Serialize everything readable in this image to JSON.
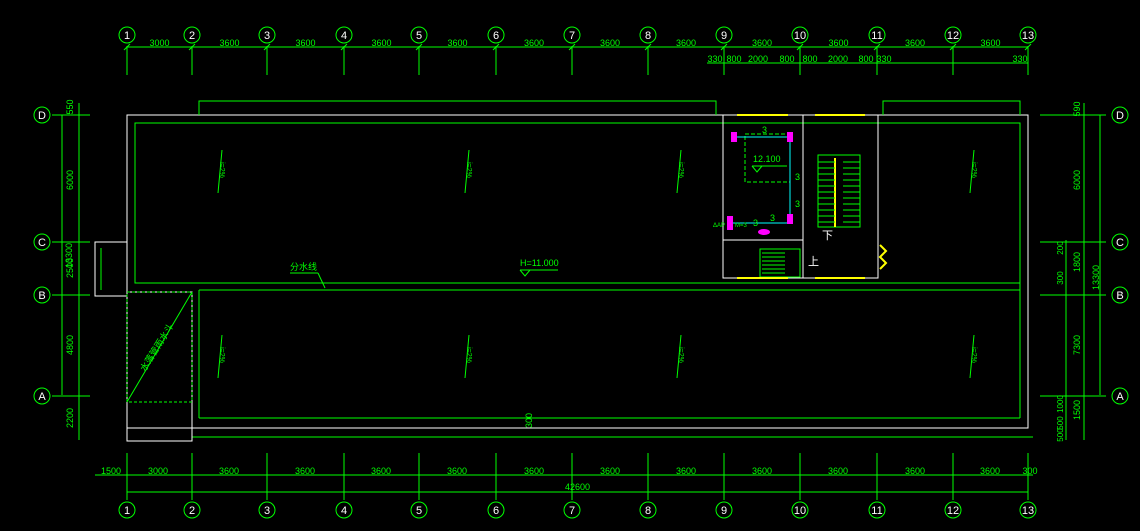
{
  "grid_x_labels": [
    "1",
    "2",
    "3",
    "4",
    "5",
    "6",
    "7",
    "8",
    "9",
    "10",
    "11",
    "12",
    "13"
  ],
  "grid_y_labels": [
    "D",
    "C",
    "B",
    "A"
  ],
  "top_dims": [
    "3000",
    "3600",
    "3600",
    "3600",
    "3600",
    "3600",
    "3600",
    "3600",
    "3600",
    "3600",
    "3600",
    "3600"
  ],
  "top_sub_dims": [
    "330",
    "800",
    "2000",
    "800",
    "800",
    "2000",
    "800",
    "330",
    "330"
  ],
  "bottom_dims": [
    "1500",
    "3000",
    "3600",
    "3600",
    "3600",
    "3600",
    "3600",
    "3600",
    "3600",
    "3600",
    "3600",
    "3600",
    "3600",
    "300"
  ],
  "bottom_total": "42600",
  "left_dims": [
    "550",
    "6000",
    "2500",
    "4800",
    "2200"
  ],
  "left_total": "13300",
  "right_dims": [
    "590",
    "6000",
    "1800",
    "7300",
    "1500"
  ],
  "right_total": "13300",
  "right_small_dims": [
    "200",
    "300",
    "1000",
    "500",
    "500"
  ],
  "annotations": {
    "elevation": "H=11.000",
    "stair_elevation": "12.100",
    "divide_line": "分水线",
    "slope": "i=2%",
    "center_mark": "300",
    "stair_down": "下",
    "stair_up": "上",
    "diag_label": "水落管雨水斗",
    "three": "3",
    "small_label": "ΔAP",
    "small_label2": "M=3"
  }
}
